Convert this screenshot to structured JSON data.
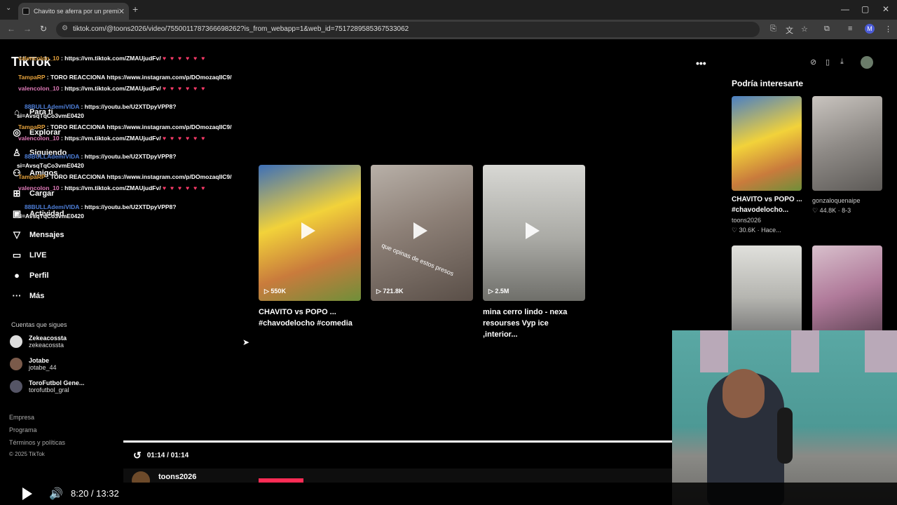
{
  "browser": {
    "tab_title": "Chavito se aferra por un premi",
    "tab_close": "✕",
    "new_tab": "+",
    "url": "tiktok.com/@toons2026/video/7550011787366698262?is_from_webapp=1&web_id=7517289585367533062",
    "profile_initial": "M"
  },
  "sidebar": {
    "logo": "TikTok",
    "items": [
      {
        "label": "Para ti",
        "icon": "home-icon"
      },
      {
        "label": "Explorar",
        "icon": "compass-icon"
      },
      {
        "label": "Siguiendo",
        "icon": "following-icon"
      },
      {
        "label": "Amigos",
        "icon": "friends-icon"
      },
      {
        "label": "Cargar",
        "icon": "upload-icon"
      },
      {
        "label": "Actividad",
        "icon": "activity-icon"
      },
      {
        "label": "Mensajes",
        "icon": "messages-icon"
      },
      {
        "label": "LIVE",
        "icon": "live-icon"
      },
      {
        "label": "Perfil",
        "icon": "profile-icon"
      },
      {
        "label": "Más",
        "icon": "more-icon"
      }
    ],
    "following_label": "Cuentas que sigues",
    "following": [
      {
        "name": "Zekeacossta",
        "handle": "zekeacossta"
      },
      {
        "name": "Jotabe",
        "handle": "jotabe_44"
      },
      {
        "name": "ToroFutbol Gene...",
        "handle": "torofutbol_gral"
      }
    ],
    "footer": [
      "Empresa",
      "Programa",
      "Términos y políticas",
      "© 2025 TikTok"
    ]
  },
  "chat": [
    {
      "user": "valencolon_10",
      "text": " : https://vm.tiktok.com/ZMAUjudFv/"
    },
    {
      "user": "TampaRP",
      "text": " : TORO REACCIONA https://www.instagram.com/p/DOmozaqIIC9/"
    },
    {
      "user": "valencolon_10",
      "text": " : https://vm.tiktok.com/ZMAUjudFv/"
    },
    {
      "user": "88BULLAdemiVIDA",
      "text": " : https://youtu.be/U2XTDpyVPP8?"
    },
    {
      "user": "",
      "text": "si=AvsqTqCo3vmE0420"
    },
    {
      "user": "TampaRP",
      "text": " : TORO REACCIONA https://www.instagram.com/p/DOmozaqIIC9/"
    },
    {
      "user": "valencolon_10",
      "text": " : https://vm.tiktok.com/ZMAUjudFv/"
    },
    {
      "user": "88BULLAdemiVIDA",
      "text": " : https://youtu.be/U2XTDpyVPP8?"
    },
    {
      "user": "",
      "text": "si=AvsqTqCo3vmE0420"
    },
    {
      "user": "TampaRP",
      "text": " : TORO REACCIONA https://www.instagram.com/p/DOmozaqIIC9/"
    },
    {
      "user": "valencolon_10",
      "text": " : https://vm.tiktok.com/ZMAUjudFv/"
    },
    {
      "user": "88BULLAdemiVIDA",
      "text": " : https://youtu.be/U2XTDpyVPP8?"
    },
    {
      "user": "",
      "text": "si=AvsqTqCo3vmE0420"
    }
  ],
  "videos": [
    {
      "views": "550K",
      "title": "CHAVITO vs POPO ... #chavodelocho #comedia",
      "color": "#3d6fb8"
    },
    {
      "views": "721.8K",
      "title": "",
      "caption": "que opinas de estos presos",
      "color": "#8c7f76"
    },
    {
      "views": "2.5M",
      "title": "mina cerro lindo - nexa resourses Vyp ice ,interior...",
      "color": "#a9a9a4"
    }
  ],
  "recommended": {
    "title": "Podría interesarte",
    "items": [
      {
        "title": "CHAVITO vs POPO ...",
        "sub1": "#chavodelocho...",
        "sub2": "toons2026",
        "sub3": "♡ 30.6K · Hace...",
        "color": "#4a7fc4"
      },
      {
        "title": "gonzaloquenaipe",
        "sub1": "♡ 44.8K · 8-3",
        "sub2": "",
        "sub3": "",
        "color": "#8e8a86"
      },
      {
        "title": "",
        "sub1": "",
        "sub2": "",
        "sub3": "",
        "color": "#b5b5b0"
      },
      {
        "title": "",
        "sub1": "",
        "sub2": "",
        "sub3": "",
        "color": "#b07a9a"
      }
    ]
  },
  "player": {
    "video_time": "01:14 / 01:14",
    "stream_time": "8:20 / 13:32",
    "author": "toons2026",
    "progress": 1.0
  }
}
